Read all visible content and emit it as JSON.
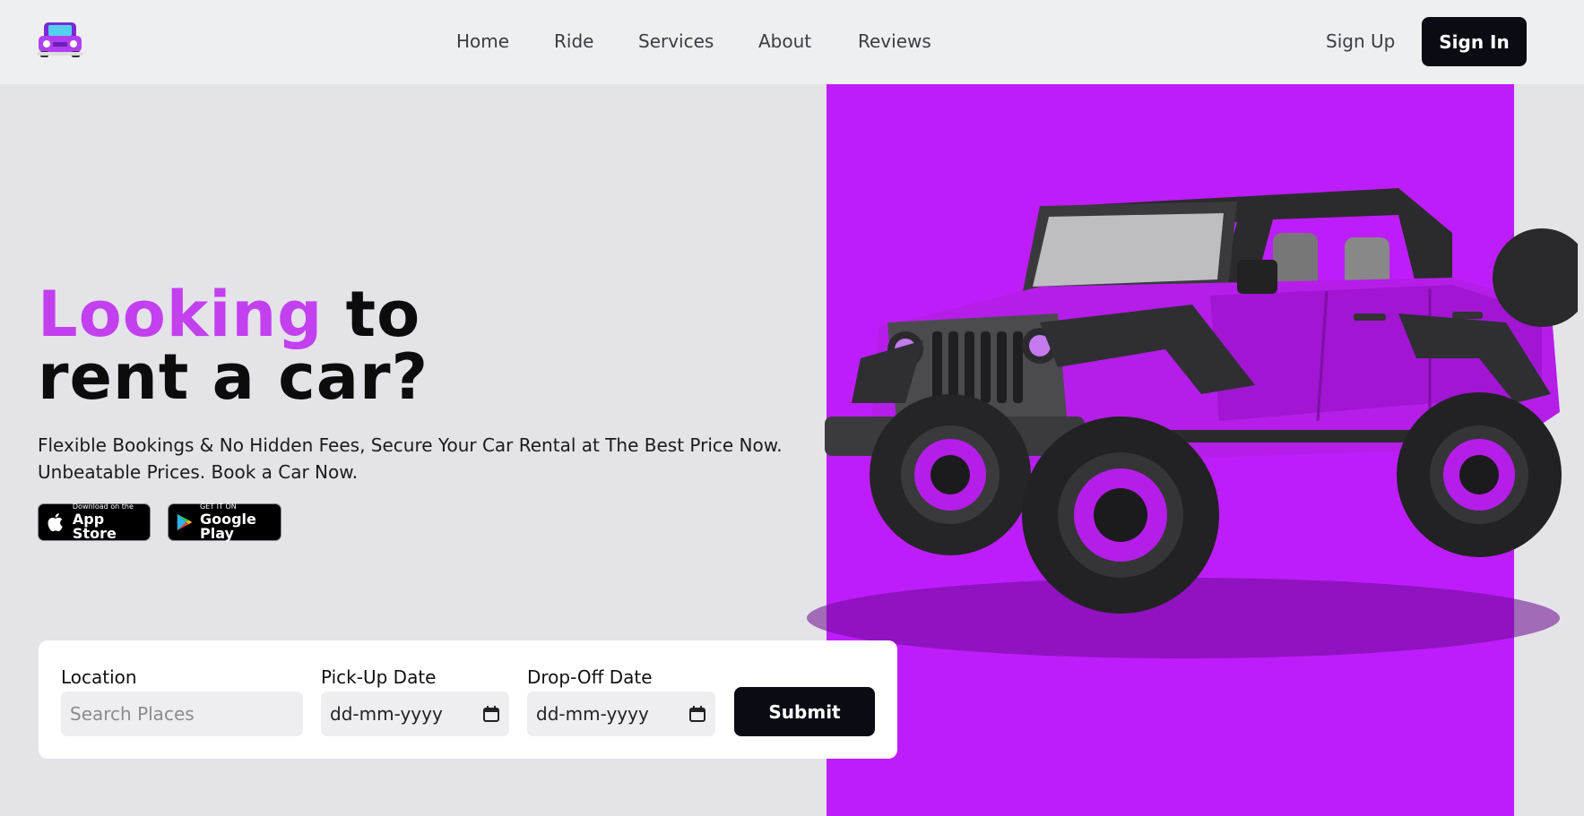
{
  "header": {
    "logo_icon": "purple-car-icon",
    "nav": [
      "Home",
      "Ride",
      "Services",
      "About",
      "Reviews"
    ],
    "sign_up": "Sign Up",
    "sign_in": "Sign In"
  },
  "hero": {
    "headline_accent": "Looking",
    "headline_rest1": " to",
    "headline_line2": "rent a car?",
    "subtext_line1": "Flexible Bookings & No Hidden Fees, Secure Your Car Rental at The Best Price Now.",
    "subtext_line2": "Unbeatable Prices. Book a Car Now.",
    "app_store": {
      "small": "Download on the",
      "big": "App Store",
      "icon": "apple-icon"
    },
    "google_play": {
      "small": "GET IT ON",
      "big": "Google Play",
      "icon": "google-play-icon"
    },
    "image": "purple-jeep-image"
  },
  "booking": {
    "location_label": "Location",
    "location_placeholder": "Search Places",
    "pickup_label": "Pick-Up Date",
    "pickup_value": "dd-mm-yyyy",
    "dropoff_label": "Drop-Off Date",
    "dropoff_value": "dd-mm-yyyy",
    "submit": "Submit"
  },
  "colors": {
    "accent": "#c340ef",
    "hero_bg": "#be1dfb",
    "dark_button": "#0b0b14"
  }
}
